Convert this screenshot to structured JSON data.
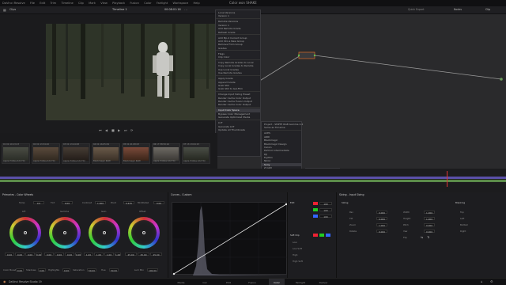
{
  "menubar": {
    "items": [
      "DaVinci Resolve",
      "File",
      "Edit",
      "Trim",
      "Timeline",
      "Clip",
      "Mark",
      "View",
      "Playback",
      "Fusion",
      "Color",
      "Fairlight",
      "Workspace",
      "Help"
    ],
    "app_title": "Color won SHAKE"
  },
  "viewer": {
    "zoom": "Clips",
    "timeline_label": "Timeline 1",
    "timecode": "00:08:01:16"
  },
  "node_toolbar": {
    "label": "Clip"
  },
  "node_menu": {
    "items": [
      "Local Versions",
      "Version 1",
      "Remote Versions",
      "Version 1",
      "Add Remote Grade",
      "Refresh Grade",
      "Add Mp.4 Current Group",
      "Add Into a New Group",
      "Remove From Group",
      "Grades",
      "Flags",
      "Clip Color",
      "Copy Remote Grades to Local",
      "Copy Local Grades to Remote",
      "Use Local Grades",
      "Use Remote Grades",
      "Apply Grade",
      "Append Grade",
      "Grab Still",
      "Grab Still to Gal-Film",
      "Change Input Sizing Preset",
      "Render Cache Color Output",
      "Render Cache Fusion Output",
      "Render Cache Color Output",
      "Input Color Space",
      "Bypass Color Management",
      "Generate Optimized Media",
      "LUT",
      "Generate LUT",
      "Update All Thumbnails"
    ],
    "highlight_index": 24
  },
  "colorspace_menu": {
    "items": [
      "Project - SMPTE RGB Gamma 2.4",
      "Same as Timeline",
      "ACES",
      "ARRI",
      "Blackmagic",
      "Blackmagic Design",
      "Canon",
      "DaVinci Intermediate",
      "DJI",
      "Fujifilm",
      "Nikon",
      "Sony",
      "Z CAM",
      "P3",
      "Rec.709",
      "Rec.2020",
      "sRGB",
      "XYZ"
    ],
    "highlight_index": 11
  },
  "sony_submenu": {
    "items": [
      "Sony S-Gamut",
      "Sony S-Gamut3",
      "Sony S-Gamut3.Cine"
    ],
    "highlight_index": 2
  },
  "clips": [
    {
      "num": "01",
      "tc": "01:10:13:23",
      "fmt": "Apple ProRes 422 HQ"
    },
    {
      "num": "02",
      "tc": "01:13:34:20",
      "fmt": "Apple ProRes 422 HQ"
    },
    {
      "num": "03",
      "tc": "01:13:44:08",
      "fmt": "Apple ProRes 422 HQ"
    },
    {
      "num": "04",
      "tc": "01:16:05:09",
      "fmt": "Blackmagic RAW"
    },
    {
      "num": "05",
      "tc": "01:41:08:03",
      "fmt": "Blackmagic RAW"
    },
    {
      "num": "06",
      "tc": "17:58:59:16",
      "fmt": "Apple ProRes 422 HQ"
    },
    {
      "num": "07",
      "tc": "13:13:04:15",
      "fmt": "Apple ProRes 422 HQ"
    }
  ],
  "primaries": {
    "title": "Primaries - Color Wheels",
    "temp_label": "Temp",
    "temp_value": "0.0",
    "tint_label": "Tint",
    "tint_value": "0.00",
    "contrast_label": "Contrast",
    "contrast_value": "1.000",
    "pivot_label": "Pivot",
    "pivot_value": "0.435",
    "middetail_label": "Mid/Detail",
    "middetail_value": "0.00",
    "wheels": [
      {
        "name": "Lift",
        "values": [
          "0.00",
          "0.00",
          "0.00",
          "0.00"
        ]
      },
      {
        "name": "Gamma",
        "values": [
          "0.00",
          "0.00",
          "0.00",
          "0.00"
        ]
      },
      {
        "name": "Gain",
        "values": [
          "1.00",
          "1.00",
          "1.00",
          "1.00"
        ]
      },
      {
        "name": "Offset",
        "values": [
          "25.00",
          "25.00",
          "25.00"
        ]
      }
    ],
    "bottom": {
      "colorboost_label": "Color Boost",
      "colorboost_value": "0.00",
      "shadows_label": "Shadows",
      "shadows_value": "0.00",
      "highlights_label": "Highlights",
      "highlights_value": "0.00",
      "saturation_label": "Saturation",
      "saturation_value": "50.00",
      "hue_label": "Hue",
      "hue_value": "50.00",
      "lummix_label": "Lum Mix",
      "lummix_value": "100.00"
    }
  },
  "curves": {
    "title": "Curves - Custom"
  },
  "edit": {
    "title": "Edit",
    "softclip": "Soft Clip",
    "rows": [
      "Low",
      "Low Soft",
      "High",
      "High Soft"
    ]
  },
  "lgamma": {
    "title": "Sizing - Input Sizing",
    "section": "Sizing",
    "left": [
      {
        "label": "Pan",
        "value": "0.000"
      },
      {
        "label": "Tilt",
        "value": "0.000"
      },
      {
        "label": "Zoom",
        "value": "1.000"
      },
      {
        "label": "Rotate",
        "value": "0.000"
      }
    ],
    "right": [
      {
        "label": "Width",
        "value": "1.000"
      },
      {
        "label": "Height",
        "value": "1.000"
      },
      {
        "label": "Pitch",
        "value": "0.000"
      },
      {
        "label": "Yaw",
        "value": "0.000"
      },
      {
        "label": "Flip",
        "value": ""
      }
    ],
    "blanking_label": "Blanking",
    "blanking_rows": [
      "Top",
      "Left",
      "Bottom",
      "Right"
    ]
  },
  "pagebar": {
    "brand": "DaVinci Resolve Studio 19",
    "pages": [
      "Media",
      "Cut",
      "Edit",
      "Fusion",
      "Color",
      "Fairlight",
      "Deliver"
    ],
    "active_index": 4
  }
}
